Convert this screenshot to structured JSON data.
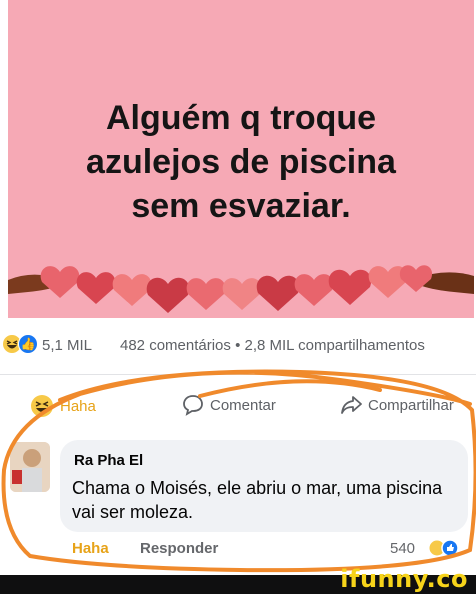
{
  "post": {
    "image_text_lines": [
      "Alguém q troque",
      "azulejos de piscina",
      "sem esvaziar."
    ],
    "background_color": "#f6a9b5"
  },
  "reactions": {
    "icons": [
      "haha-icon",
      "like-icon"
    ],
    "count": "5,1 MIL",
    "comments_and_shares": "482 comentários • 2,8 MIL compartilhamentos"
  },
  "actions": {
    "haha": "Haha",
    "comment": "Comentar",
    "share": "Compartilhar"
  },
  "comment": {
    "author": "Ra Pha El",
    "text": "Chama o Moisés,  ele abriu o mar, uma piscina vai ser moleza.",
    "haha": "Haha",
    "reply": "Responder",
    "reaction_count": "540"
  },
  "watermark": "ifunny.co",
  "colors": {
    "facebook_blue": "#1877f2",
    "haha_orange": "#e7a319",
    "scribble_orange": "#f08a2c",
    "ifunny_yellow": "#f6d31a"
  }
}
